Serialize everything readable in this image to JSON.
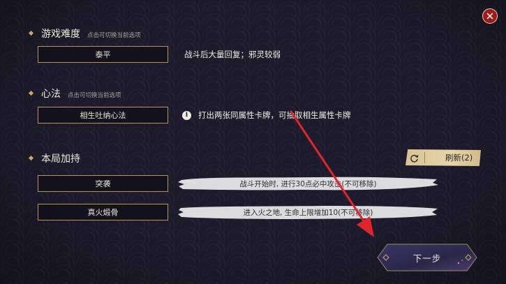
{
  "difficulty": {
    "title": "游戏难度",
    "hint": "点击可切换当前选项",
    "option": "泰平",
    "description": "战斗后大量回复；邪灵较弱"
  },
  "mindset": {
    "title": "心法",
    "hint": "点击可切换当前选项",
    "option": "相生吐纳心法",
    "info_icon": "i",
    "description": "打出两张同属性卡牌，可抽取相生属性卡牌"
  },
  "buffs": {
    "title": "本局加持",
    "refresh_label": "刷新(2)",
    "items": [
      {
        "name": "突袭",
        "description": "战斗开始时, 进行30点必中攻击(不可移除)"
      },
      {
        "name": "真火煅骨",
        "description": "进入火之地, 生命上限增加10(不可移除)"
      }
    ]
  },
  "next_label": "下一步",
  "colors": {
    "accent_gold": "#b3955f",
    "close_red": "#9b1b21",
    "annotation_arrow": "#e0262b"
  },
  "icons": [
    "close-icon",
    "info-icon",
    "refresh-icon",
    "diamond-bullet-icon"
  ]
}
